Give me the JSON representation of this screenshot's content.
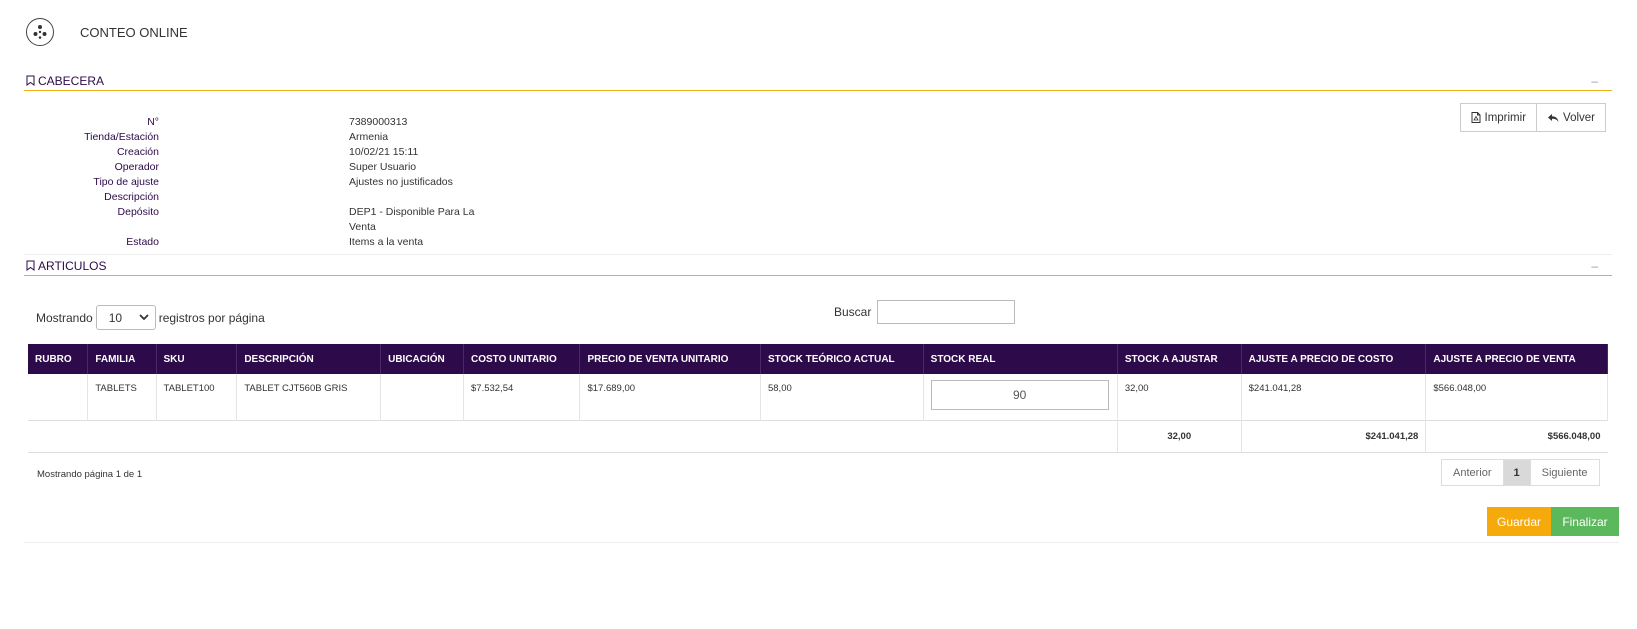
{
  "app": {
    "title": "CONTEO ONLINE",
    "logo_icon": "flower-logo-icon"
  },
  "cabecera": {
    "title": "CABECERA",
    "collapse_symbol": "–",
    "fields": [
      {
        "label": "N°",
        "value": "7389000313"
      },
      {
        "label": "Tienda/Estación",
        "value": "Armenia"
      },
      {
        "label": "Creación",
        "value": "10/02/21 15:11"
      },
      {
        "label": "Operador",
        "value": "Super Usuario"
      },
      {
        "label": "Tipo de ajuste",
        "value": "Ajustes no justificados"
      },
      {
        "label": "Descripción",
        "value": ""
      },
      {
        "label": "Depósito",
        "value": "DEP1 - Disponible Para La Venta"
      },
      {
        "label": "Estado",
        "value": "Items a la venta"
      }
    ],
    "buttons": {
      "print": "Imprimir",
      "back": "Volver"
    }
  },
  "articulos": {
    "title": "ARTICULOS",
    "collapse_symbol": "–",
    "showing_prefix": "Mostrando",
    "page_size": "10",
    "showing_suffix": "registros por página",
    "search_label": "Buscar",
    "search_value": "",
    "columns": [
      "RUBRO",
      "FAMILIA",
      "SKU",
      "DESCRIPCIÓN",
      "UBICACIÓN",
      "COSTO UNITARIO",
      "PRECIO DE VENTA UNITARIO",
      "STOCK TEÓRICO ACTUAL",
      "STOCK REAL",
      "STOCK A AJUSTAR",
      "AJUSTE A PRECIO DE COSTO",
      "AJUSTE A PRECIO DE VENTA"
    ],
    "rows": [
      {
        "rubro": "",
        "familia": "TABLETS",
        "sku": "TABLET100",
        "descripcion": "TABLET CJT560B GRIS",
        "ubicacion": "",
        "costo_unitario": "$7.532,54",
        "precio_venta_unitario": "$17.689,00",
        "stock_teorico": "58,00",
        "stock_real": "90",
        "stock_ajustar": "32,00",
        "ajuste_costo": "$241.041,28",
        "ajuste_venta": "$566.048,00"
      }
    ],
    "totals": {
      "stock_ajustar": "32,00",
      "ajuste_costo": "$241.041,28",
      "ajuste_venta": "$566.048,00"
    },
    "page_info": "Mostrando página 1 de 1",
    "pagination": {
      "prev": "Anterior",
      "current": "1",
      "next": "Siguiente"
    }
  },
  "actions": {
    "save": "Guardar",
    "finish": "Finalizar"
  },
  "colors": {
    "primary": "#2d0a4a",
    "accent": "#f0ad16",
    "save": "#f5a90a",
    "finish": "#5cb85c"
  }
}
